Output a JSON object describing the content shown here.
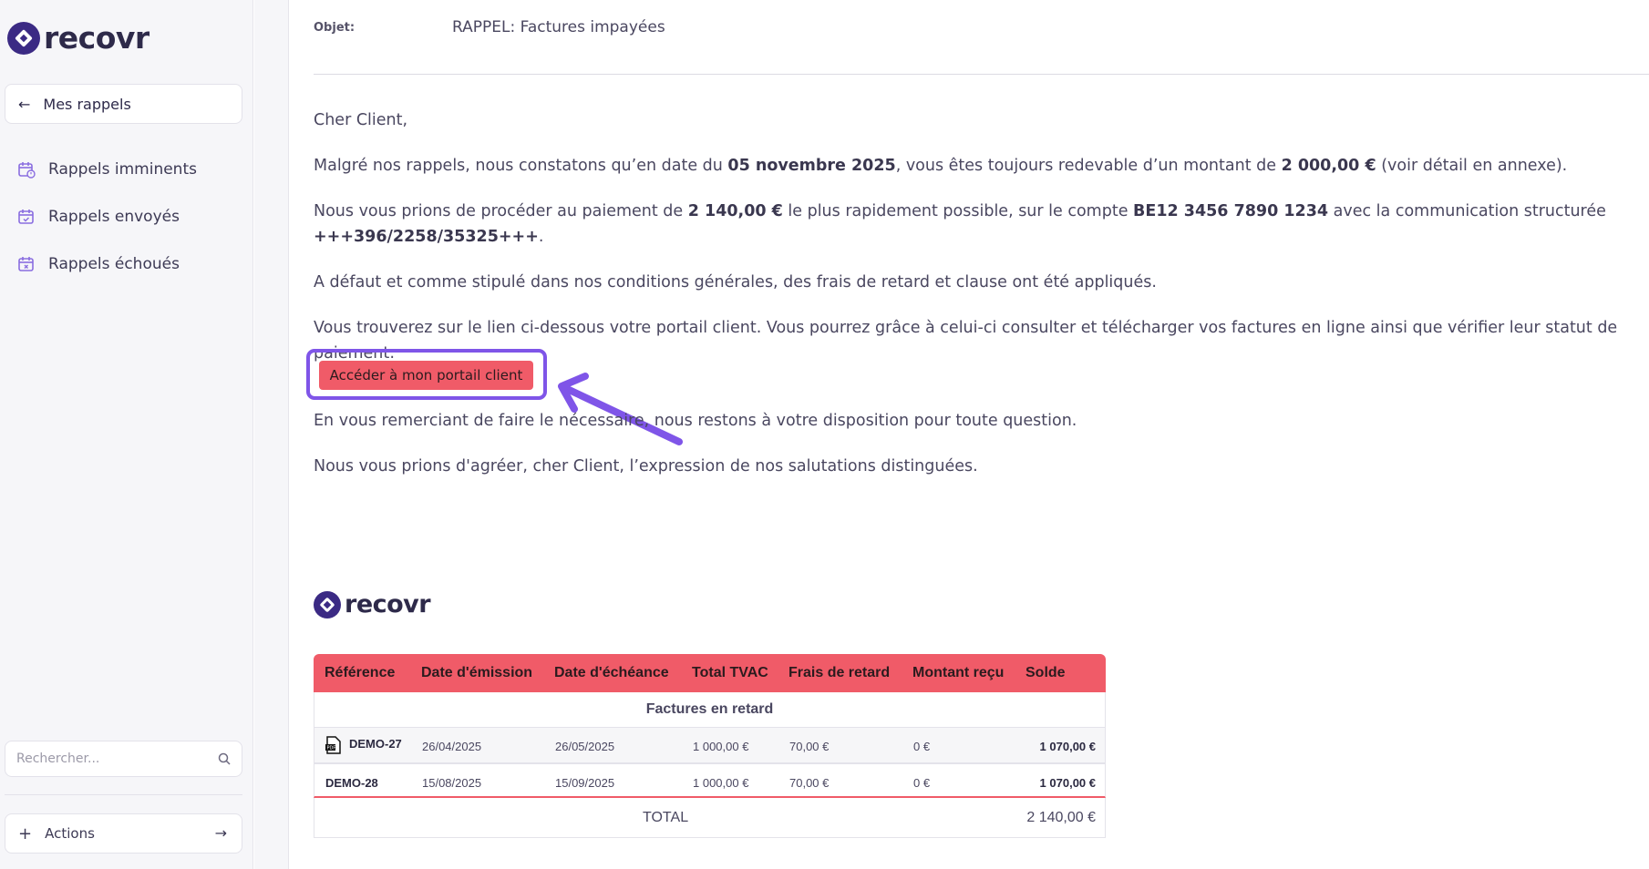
{
  "sidebar": {
    "logo_text": "recovr",
    "back_label": "Mes rappels",
    "items": [
      {
        "label": "Rappels imminents"
      },
      {
        "label": "Rappels envoyés"
      },
      {
        "label": "Rappels échoués"
      }
    ],
    "search_placeholder": "Rechercher...",
    "actions_label": "Actions"
  },
  "email": {
    "subject_label": "Objet:",
    "subject_value": "RAPPEL: Factures impayées",
    "greeting": "Cher Client,",
    "p1_a": "Malgré nos rappels, nous constatons qu’en date du ",
    "p1_date": "05 novembre 2025",
    "p1_b": ", vous êtes toujours redevable d’un montant de ",
    "p1_amount": "2 000,00 €",
    "p1_c": " (voir détail en annexe).",
    "p2_a": "Nous vous prions de procéder au paiement de ",
    "p2_amount": "2 140,00 €",
    "p2_b": " le plus rapidement possible, sur le compte ",
    "p2_account": "BE12 3456 7890 1234",
    "p2_c": " avec la communication structurée ",
    "p2_comm": "+++396/2258/35325+++",
    "p2_d": ".",
    "p3": "A défaut et comme stipulé dans nos conditions générales, des frais de retard et clause ont été appliqués.",
    "p4": "Vous trouverez sur le lien ci-dessous votre portail client. Vous pourrez grâce à celui-ci consulter et télécharger vos factures en ligne ainsi que vérifier leur statut de paiement:",
    "portal_button": "Accéder à mon portail client",
    "p5": "En vous remerciant de faire le nécessaire, nous restons à votre disposition pour toute question.",
    "p6": "Nous vous prions d'agréer, cher Client, l’expression de nos salutations distinguées.",
    "logo_text": "recovr"
  },
  "invoice_table": {
    "headers": [
      "Référence",
      "Date d'émission",
      "Date d'échéance",
      "Total TVAC",
      "Frais de retard",
      "Montant reçu",
      "Solde"
    ],
    "section_title": "Factures en retard",
    "rows": [
      {
        "ref": "DEMO-27",
        "emission": "26/04/2025",
        "echeance": "26/05/2025",
        "total": "1 000,00 €",
        "frais": "70,00 €",
        "recu": "0 €",
        "solde": "1 070,00 €"
      },
      {
        "ref": "DEMO-28",
        "emission": "15/08/2025",
        "echeance": "15/09/2025",
        "total": "1 000,00 €",
        "frais": "70,00 €",
        "recu": "0 €",
        "solde": "1 070,00 €"
      }
    ],
    "total_label": "TOTAL",
    "total_value": "2 140,00 €"
  },
  "colors": {
    "brand": "#3b2a84",
    "accent_red": "#f05b68",
    "annotation": "#7f55e8"
  }
}
